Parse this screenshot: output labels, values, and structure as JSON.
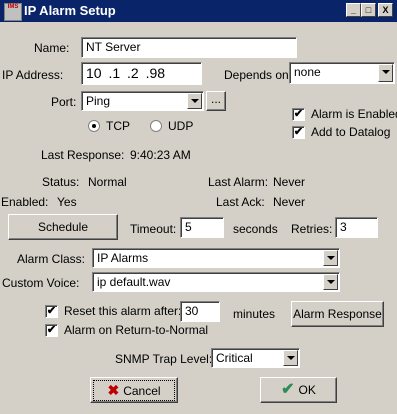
{
  "window": {
    "title": "IP Alarm Setup",
    "icon_label": "IMS",
    "minimize": "_",
    "maximize": "□",
    "close": "X"
  },
  "form": {
    "name_label": "Name:",
    "name_value": "NT Server",
    "ip_label": "IP Address:",
    "ip_value": "10 .1 .2 .98",
    "depends_label": "Depends on:",
    "depends_value": "none",
    "port_label": "Port:",
    "port_value": "Ping",
    "browse_label": "...",
    "tcp_label": "TCP",
    "udp_label": "UDP",
    "protocol_selected": "TCP",
    "alarm_enabled_label": "Alarm is Enabled",
    "alarm_enabled_checked": true,
    "add_datalog_label": "Add to Datalog",
    "add_datalog_checked": true,
    "last_response_label": "Last Response:",
    "last_response_value": "9:40:23 AM",
    "status_label": "Status:",
    "status_value": "Normal",
    "last_alarm_label": "Last Alarm:",
    "last_alarm_value": "Never",
    "enabled_label": "Enabled:",
    "enabled_value": "Yes",
    "last_ack_label": "Last Ack:",
    "last_ack_value": "Never",
    "schedule_label": "Schedule",
    "timeout_label": "Timeout:",
    "timeout_value": "5",
    "seconds_label": "seconds",
    "retries_label": "Retries:",
    "retries_value": "3",
    "alarm_class_label": "Alarm Class:",
    "alarm_class_value": "IP Alarms",
    "custom_voice_label": "Custom Voice:",
    "custom_voice_value": "ip default.wav",
    "reset_label": "Reset this alarm after:",
    "reset_checked": true,
    "reset_value": "30",
    "minutes_label": "minutes",
    "alarm_response_label": "Alarm Response",
    "return_normal_label": "Alarm on Return-to-Normal",
    "return_normal_checked": true,
    "snmp_label": "SNMP Trap Level:",
    "snmp_value": "Critical",
    "cancel_label": "Cancel",
    "ok_label": "OK"
  }
}
